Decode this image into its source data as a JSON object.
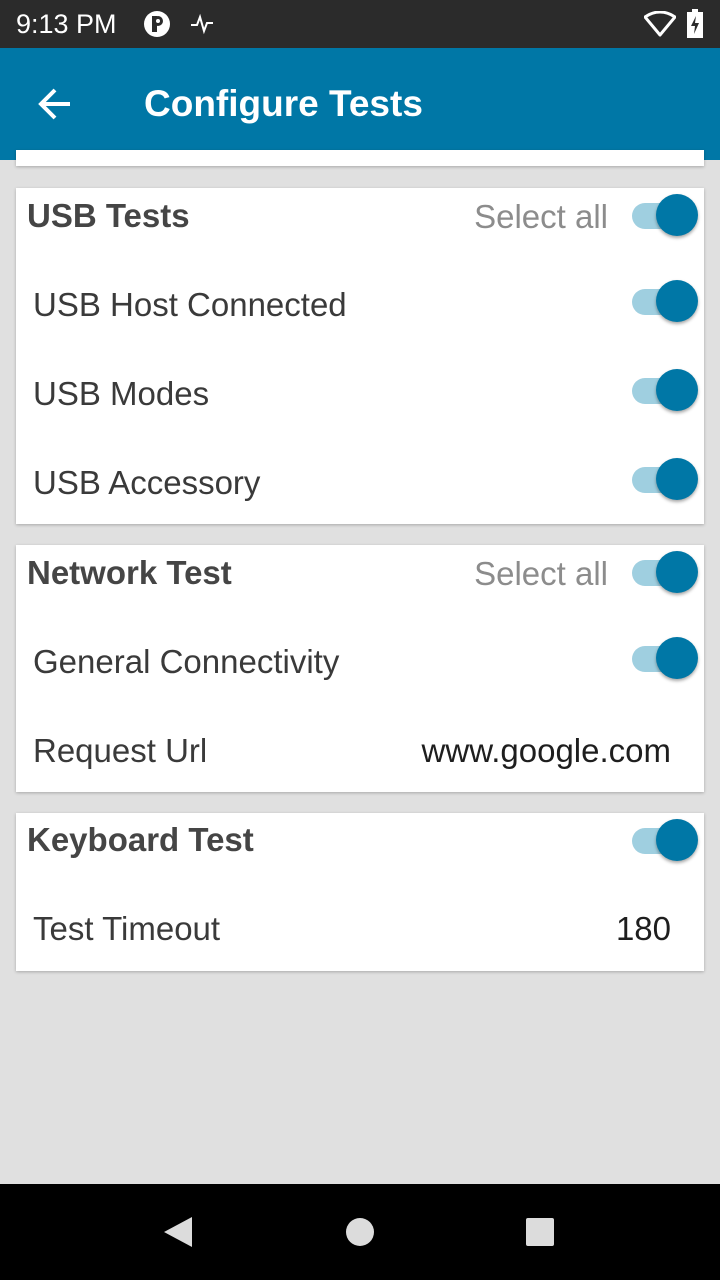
{
  "status_bar": {
    "time": "9:13 PM",
    "icons": [
      "app-notification-icon",
      "activity-icon",
      "wifi-icon",
      "battery-charging-icon"
    ]
  },
  "app_bar": {
    "title": "Configure Tests",
    "back_icon": "arrow-back-icon"
  },
  "sections": {
    "usb": {
      "title": "USB Tests",
      "select_all_label": "Select all",
      "select_all_on": true,
      "items": [
        {
          "label": "USB Host Connected",
          "on": true
        },
        {
          "label": "USB Modes",
          "on": true
        },
        {
          "label": "USB Accessory",
          "on": true
        }
      ]
    },
    "network": {
      "title": "Network Test",
      "select_all_label": "Select all",
      "select_all_on": true,
      "items": [
        {
          "label": "General Connectivity",
          "on": true
        }
      ],
      "request_url": {
        "label": "Request Url",
        "value": "www.google.com"
      }
    },
    "keyboard": {
      "title": "Keyboard Test",
      "enabled": true,
      "timeout": {
        "label": "Test Timeout",
        "value": "180"
      }
    }
  },
  "nav_bar": {
    "buttons": [
      "back-triangle-icon",
      "home-circle-icon",
      "recents-square-icon"
    ]
  },
  "colors": {
    "primary": "#0077a6",
    "switch_track": "#9fcfe0",
    "background": "#e0e0e0"
  }
}
